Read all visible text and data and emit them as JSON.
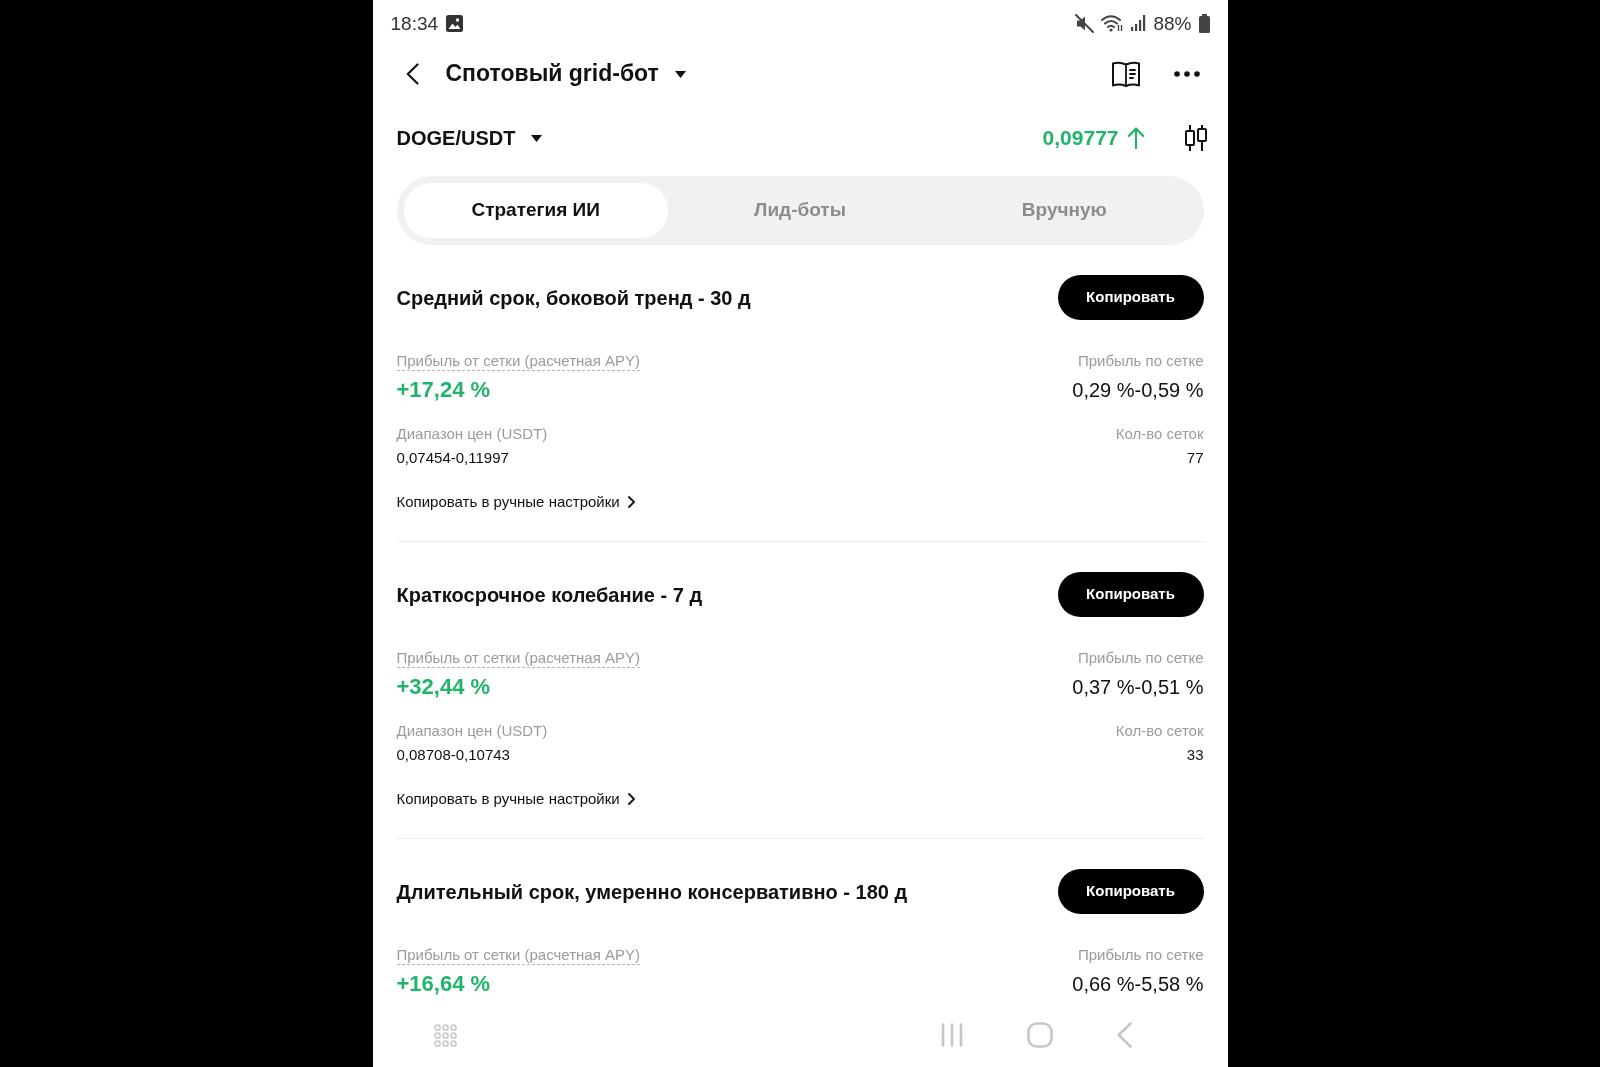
{
  "status_bar": {
    "time": "18:34",
    "battery": "88%"
  },
  "header": {
    "title": "Спотовый grid-бот"
  },
  "pair": {
    "symbol": "DOGE/USDT",
    "price": "0,09777",
    "rising": true
  },
  "tabs": [
    {
      "label": "Стратегия ИИ",
      "selected": true
    },
    {
      "label": "Лид-боты",
      "selected": false
    },
    {
      "label": "Вручную",
      "selected": false
    }
  ],
  "strategies": [
    {
      "title": "Средний срок, боковой тренд - 30 д",
      "button": "Копировать",
      "apy_label": "Прибыль от сетки (расчетная APY)",
      "apy": "+17,24 %",
      "grid_profit_label": "Прибыль по сетке",
      "grid_profit": "0,29 %-0,59 %",
      "range_label": "Диапазон цен (USDT)",
      "range": "0,07454-0,11997",
      "grid_count_label": "Кол-во сеток",
      "grid_count": "77",
      "link": "Копировать в ручные настройки"
    },
    {
      "title": "Краткосрочное колебание - 7 д",
      "button": "Копировать",
      "apy_label": "Прибыль от сетки (расчетная APY)",
      "apy": "+32,44 %",
      "grid_profit_label": "Прибыль по сетке",
      "grid_profit": "0,37 %-0,51 %",
      "range_label": "Диапазон цен (USDT)",
      "range": "0,08708-0,10743",
      "grid_count_label": "Кол-во сеток",
      "grid_count": "33",
      "link": "Копировать в ручные настройки"
    },
    {
      "title": "Длительный срок, умеренно консервативно - 180 д",
      "button": "Копировать",
      "apy_label": "Прибыль от сетки (расчетная APY)",
      "apy": "+16,64 %",
      "grid_profit_label": "Прибыль по сетке",
      "grid_profit": "0,66 %-5,58 %"
    }
  ]
}
